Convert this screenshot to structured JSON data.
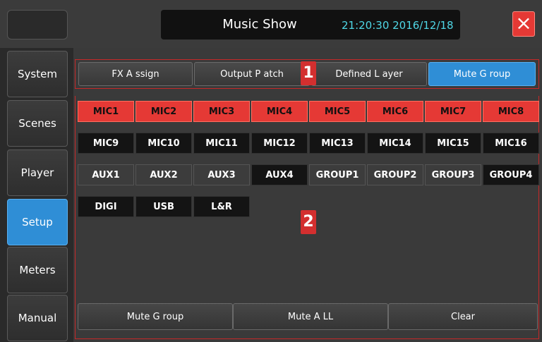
{
  "window": {
    "title": "Music Show",
    "clock": "21:20:30 2016/12/18",
    "close_icon": "×"
  },
  "sidebar": {
    "items": [
      {
        "label": "System"
      },
      {
        "label": "Scenes"
      },
      {
        "label": "Player"
      },
      {
        "label": "Setup",
        "active": true
      },
      {
        "label": "Meters"
      },
      {
        "label": "Manual"
      }
    ]
  },
  "tabs": [
    {
      "label": "FX A ssign"
    },
    {
      "label": "Output P atch"
    },
    {
      "label": "Defined L ayer"
    },
    {
      "label": "Mute G roup",
      "active": true
    }
  ],
  "markers": [
    "1",
    "2"
  ],
  "channels": {
    "row1": [
      "MIC1",
      "MIC2",
      "MIC3",
      "MIC4",
      "MIC5",
      "MIC6",
      "MIC7",
      "MIC8"
    ],
    "row2": [
      "MIC9",
      "MIC10",
      "MIC11",
      "MIC12",
      "MIC13",
      "MIC14",
      "MIC15",
      "MIC16"
    ],
    "row3": [
      "AUX1",
      "AUX2",
      "AUX3",
      "AUX4",
      "GROUP1",
      "GROUP2",
      "GROUP3",
      "GROUP4"
    ],
    "row4": [
      "DIGI",
      "USB",
      "L&R"
    ]
  },
  "bottom": {
    "mute_group": "Mute G roup",
    "mute_all": "Mute A LL",
    "clear": "Clear"
  },
  "colors": {
    "accent": "#2f8ed6",
    "muted": "#e53935",
    "clock": "#4fd7e6"
  }
}
